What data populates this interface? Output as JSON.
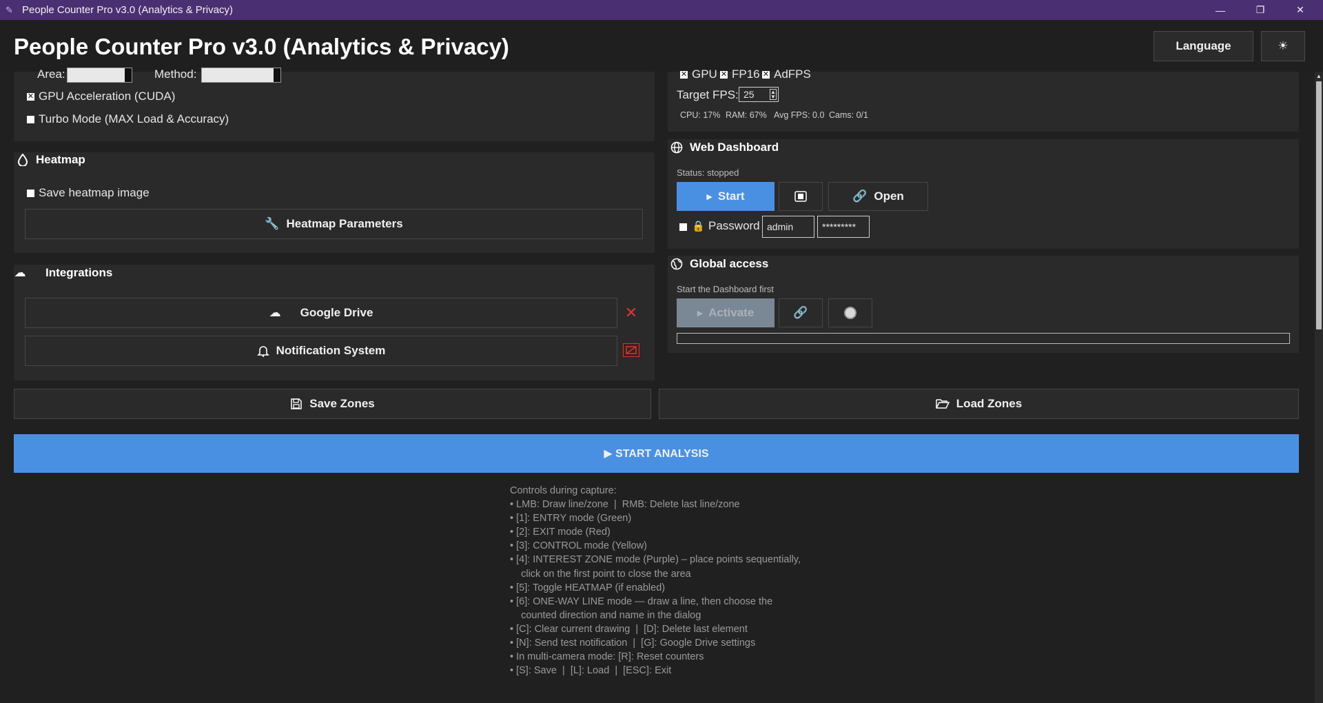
{
  "window": {
    "title": "People Counter Pro v3.0 (Analytics & Privacy)",
    "minimize": "—",
    "restore": "❐",
    "close": "✕"
  },
  "header": {
    "title": "People Counter Pro v3.0 (Analytics & Privacy)",
    "language_button": "Language",
    "theme_button": "☀"
  },
  "detection": {
    "area_label": "Area:",
    "method_label": "Method:",
    "gpu_accel": {
      "label": "GPU Acceleration (CUDA)",
      "checked": true
    },
    "turbo": {
      "label": "Turbo Mode (MAX Load & Accuracy)",
      "checked": false
    }
  },
  "performance": {
    "gpu": {
      "label": "GPU",
      "checked": true
    },
    "fp16": {
      "label": "FP16",
      "checked": true
    },
    "adfps": {
      "label": "AdFPS",
      "checked": true
    },
    "target_fps_label": "Target FPS:",
    "target_fps_value": "25",
    "stats": {
      "cpu": "CPU: 17%",
      "ram": "RAM: 67%",
      "avg_fps": "Avg FPS: 0.0",
      "cams": "Cams: 0/1"
    }
  },
  "heatmap": {
    "title": "Heatmap",
    "save_image": {
      "label": "Save heatmap image",
      "checked": false
    },
    "params_button": "Heatmap Parameters"
  },
  "integrations": {
    "title": "Integrations",
    "google_drive_button": "Google Drive",
    "notification_button": "Notification System"
  },
  "web_dashboard": {
    "title": "Web Dashboard",
    "status": "Status: stopped",
    "start_button": "Start",
    "open_button": "Open",
    "password_label": "Password",
    "user_value": "admin",
    "password_value": "*********"
  },
  "global_access": {
    "title": "Global access",
    "hint": "Start the Dashboard first",
    "activate_button": "Activate"
  },
  "zones": {
    "save_button": "Save Zones",
    "load_button": "Load Zones"
  },
  "start_analysis_button": "▶ START ANALYSIS",
  "controls_help": [
    "Controls during capture:",
    "• LMB: Draw line/zone  |  RMB: Delete last line/zone",
    "• [1]: ENTRY mode (Green)",
    "• [2]: EXIT mode (Red)",
    "• [3]: CONTROL mode (Yellow)",
    "• [4]: INTEREST ZONE mode (Purple) – place points sequentially,",
    "    click on the first point to close the area",
    "• [5]: Toggle HEATMAP (if enabled)",
    "• [6]: ONE-WAY LINE mode — draw a line, then choose the",
    "    counted direction and name in the dialog",
    "• [C]: Clear current drawing  |  [D]: Delete last element",
    "• [N]: Send test notification  |  [G]: Google Drive settings",
    "• In multi-camera mode: [R]: Reset counters",
    "• [S]: Save  |  [L]: Load  |  [ESC]: Exit"
  ],
  "colors": {
    "accent_blue": "#4a90e2",
    "title_bar": "#4b2f73",
    "danger_red": "#e0342f"
  }
}
